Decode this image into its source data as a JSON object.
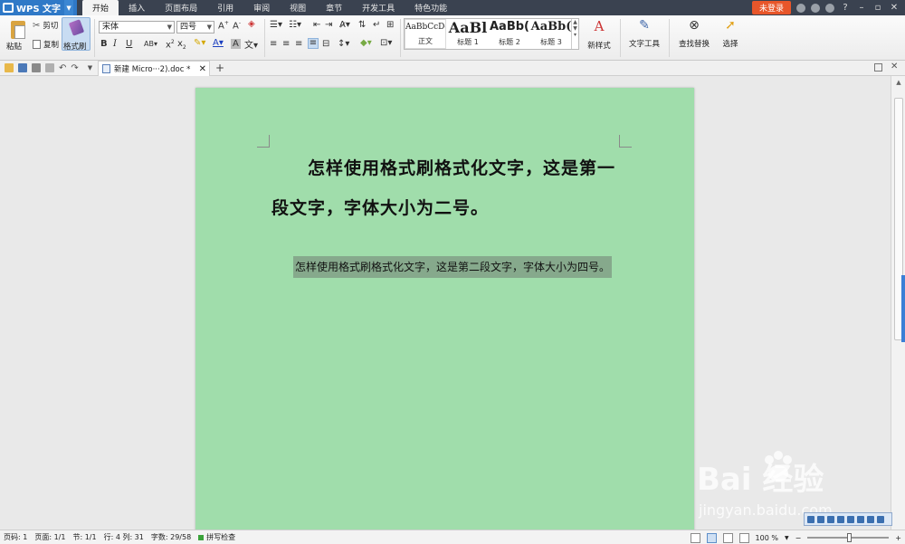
{
  "menubar": {
    "app_name": "WPS 文字",
    "tabs": [
      "开始",
      "插入",
      "页面布局",
      "引用",
      "审阅",
      "视图",
      "章节",
      "开发工具",
      "特色功能"
    ],
    "login_label": "未登录"
  },
  "ribbon": {
    "paste_label": "粘贴",
    "cut_label": "剪切",
    "copy_label": "复制",
    "format_painter_label": "格式刷",
    "font_name": "宋体",
    "font_size": "四号",
    "bold": "B",
    "italic": "I",
    "underline": "U",
    "styles": [
      {
        "preview": "AaBbCcDd",
        "name": "正文"
      },
      {
        "preview": "AaBl",
        "name": "标题 1"
      },
      {
        "preview": "AaBb(",
        "name": "标题 2"
      },
      {
        "preview": "AaBb(",
        "name": "标题 3"
      }
    ],
    "new_style_label": "新样式",
    "text_tools_label": "文字工具",
    "find_replace_label": "查找替换",
    "select_label": "选择"
  },
  "document_tab": {
    "title": "新建 Micro···2).doc *"
  },
  "document": {
    "paragraph1": "怎样使用格式刷格式化文字，这是第一段文字，字体大小为二号。",
    "paragraph2": "怎样使用格式刷格式化文字，这是第二段文字，字体大小为四号。"
  },
  "statusbar": {
    "page_code": "页码: 1",
    "page": "页面: 1/1",
    "section": "节: 1/1",
    "line_col": "行: 4  列: 31",
    "word_count": "字数: 29/58",
    "spell_check": "拼写检查",
    "zoom": "100 %"
  },
  "watermark": {
    "brand": "Bai  经验",
    "url": "jingyan.baidu.com"
  },
  "colors": {
    "page_background": "#a0ddab",
    "selection_highlight": "#86a98c",
    "menubar": "#3a4250",
    "accent": "#2f79c7"
  }
}
